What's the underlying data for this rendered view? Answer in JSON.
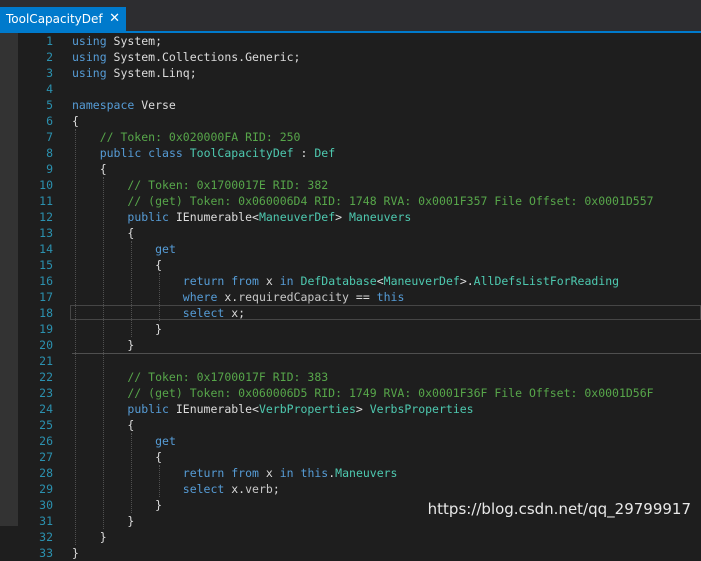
{
  "tab": {
    "title": "ToolCapacityDef",
    "close_glyph": "✕"
  },
  "watermark": "https://blog.csdn.net/qq_29799917",
  "colors": {
    "keyword": "#569cd6",
    "comment": "#57a64a",
    "type": "#4ec9b0",
    "line_number": "#2b91af",
    "text": "#dcdcdc",
    "accent": "#007acc"
  },
  "lines": [
    {
      "n": "1",
      "segments": [
        {
          "t": "using",
          "c": "kw"
        },
        {
          "t": " System;",
          "c": "id"
        }
      ]
    },
    {
      "n": "2",
      "segments": [
        {
          "t": "using",
          "c": "kw"
        },
        {
          "t": " System.Collections.Generic;",
          "c": "id"
        }
      ]
    },
    {
      "n": "3",
      "segments": [
        {
          "t": "using",
          "c": "kw"
        },
        {
          "t": " System.Linq;",
          "c": "id"
        }
      ]
    },
    {
      "n": "4",
      "segments": []
    },
    {
      "n": "5",
      "segments": [
        {
          "t": "namespace",
          "c": "kw"
        },
        {
          "t": " Verse",
          "c": "id"
        }
      ]
    },
    {
      "n": "6",
      "segments": [
        {
          "t": "{",
          "c": "id"
        }
      ]
    },
    {
      "n": "7",
      "segments": [
        {
          "t": "    // Token: 0x020000FA RID: 250",
          "c": "cm"
        }
      ]
    },
    {
      "n": "8",
      "segments": [
        {
          "t": "    ",
          "c": "id"
        },
        {
          "t": "public class",
          "c": "kw"
        },
        {
          "t": " ",
          "c": "id"
        },
        {
          "t": "ToolCapacityDef",
          "c": "ty"
        },
        {
          "t": " : ",
          "c": "id"
        },
        {
          "t": "Def",
          "c": "ty"
        }
      ]
    },
    {
      "n": "9",
      "segments": [
        {
          "t": "    {",
          "c": "id"
        }
      ]
    },
    {
      "n": "10",
      "segments": [
        {
          "t": "        // Token: 0x1700017E RID: 382",
          "c": "cm"
        }
      ]
    },
    {
      "n": "11",
      "segments": [
        {
          "t": "        // (get) Token: 0x060006D4 RID: 1748 RVA: 0x0001F357 File Offset: 0x0001D557",
          "c": "cm"
        }
      ]
    },
    {
      "n": "12",
      "segments": [
        {
          "t": "        ",
          "c": "id"
        },
        {
          "t": "public",
          "c": "kw"
        },
        {
          "t": " IEnumerable<",
          "c": "id"
        },
        {
          "t": "ManeuverDef",
          "c": "ty"
        },
        {
          "t": "> ",
          "c": "id"
        },
        {
          "t": "Maneuvers",
          "c": "ty"
        }
      ]
    },
    {
      "n": "13",
      "segments": [
        {
          "t": "        {",
          "c": "id"
        }
      ]
    },
    {
      "n": "14",
      "segments": [
        {
          "t": "            ",
          "c": "id"
        },
        {
          "t": "get",
          "c": "kw"
        }
      ]
    },
    {
      "n": "15",
      "segments": [
        {
          "t": "            {",
          "c": "id"
        }
      ]
    },
    {
      "n": "16",
      "segments": [
        {
          "t": "                ",
          "c": "id"
        },
        {
          "t": "return from",
          "c": "kw"
        },
        {
          "t": " x ",
          "c": "id"
        },
        {
          "t": "in",
          "c": "kw"
        },
        {
          "t": " ",
          "c": "id"
        },
        {
          "t": "DefDatabase",
          "c": "ty"
        },
        {
          "t": "<",
          "c": "id"
        },
        {
          "t": "ManeuverDef",
          "c": "ty"
        },
        {
          "t": ">.",
          "c": "id"
        },
        {
          "t": "AllDefsListForReading",
          "c": "ty"
        }
      ]
    },
    {
      "n": "17",
      "segments": [
        {
          "t": "                ",
          "c": "id"
        },
        {
          "t": "where",
          "c": "kw"
        },
        {
          "t": " x.",
          "c": "id"
        },
        {
          "t": "requiredCapacity",
          "c": "mb"
        },
        {
          "t": " == ",
          "c": "id"
        },
        {
          "t": "this",
          "c": "kw"
        }
      ]
    },
    {
      "n": "18",
      "segments": [
        {
          "t": "                ",
          "c": "id"
        },
        {
          "t": "select",
          "c": "kw"
        },
        {
          "t": " x;",
          "c": "id"
        }
      ]
    },
    {
      "n": "19",
      "segments": [
        {
          "t": "            }",
          "c": "id"
        }
      ]
    },
    {
      "n": "20",
      "segments": [
        {
          "t": "        }",
          "c": "id"
        }
      ]
    },
    {
      "n": "21",
      "segments": []
    },
    {
      "n": "22",
      "segments": [
        {
          "t": "        // Token: 0x1700017F RID: 383",
          "c": "cm"
        }
      ]
    },
    {
      "n": "23",
      "segments": [
        {
          "t": "        // (get) Token: 0x060006D5 RID: 1749 RVA: 0x0001F36F File Offset: 0x0001D56F",
          "c": "cm"
        }
      ]
    },
    {
      "n": "24",
      "segments": [
        {
          "t": "        ",
          "c": "id"
        },
        {
          "t": "public",
          "c": "kw"
        },
        {
          "t": " IEnumerable<",
          "c": "id"
        },
        {
          "t": "VerbProperties",
          "c": "ty"
        },
        {
          "t": "> ",
          "c": "id"
        },
        {
          "t": "VerbsProperties",
          "c": "ty"
        }
      ]
    },
    {
      "n": "25",
      "segments": [
        {
          "t": "        {",
          "c": "id"
        }
      ]
    },
    {
      "n": "26",
      "segments": [
        {
          "t": "            ",
          "c": "id"
        },
        {
          "t": "get",
          "c": "kw"
        }
      ]
    },
    {
      "n": "27",
      "segments": [
        {
          "t": "            {",
          "c": "id"
        }
      ]
    },
    {
      "n": "28",
      "segments": [
        {
          "t": "                ",
          "c": "id"
        },
        {
          "t": "return from",
          "c": "kw"
        },
        {
          "t": " x ",
          "c": "id"
        },
        {
          "t": "in",
          "c": "kw"
        },
        {
          "t": " ",
          "c": "id"
        },
        {
          "t": "this",
          "c": "kw"
        },
        {
          "t": ".",
          "c": "id"
        },
        {
          "t": "Maneuvers",
          "c": "ty"
        }
      ]
    },
    {
      "n": "29",
      "segments": [
        {
          "t": "                ",
          "c": "id"
        },
        {
          "t": "select",
          "c": "kw"
        },
        {
          "t": " x.",
          "c": "id"
        },
        {
          "t": "verb",
          "c": "mb"
        },
        {
          "t": ";",
          "c": "id"
        }
      ]
    },
    {
      "n": "30",
      "segments": [
        {
          "t": "            }",
          "c": "id"
        }
      ]
    },
    {
      "n": "31",
      "segments": [
        {
          "t": "        }",
          "c": "id"
        }
      ]
    },
    {
      "n": "32",
      "segments": [
        {
          "t": "    }",
          "c": "id"
        }
      ]
    },
    {
      "n": "33",
      "segments": [
        {
          "t": "}",
          "c": "id"
        }
      ]
    }
  ]
}
